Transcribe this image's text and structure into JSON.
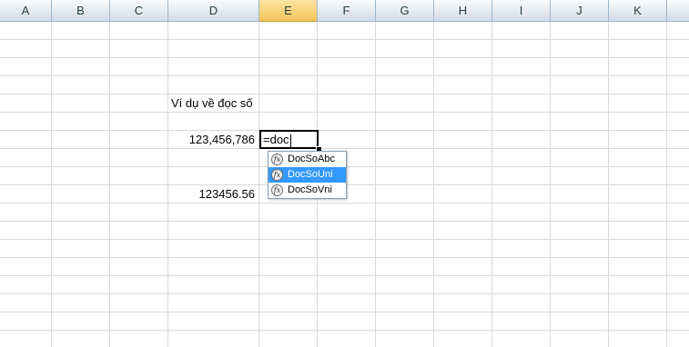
{
  "columns": [
    {
      "key": "A",
      "label": "A"
    },
    {
      "key": "B",
      "label": "B"
    },
    {
      "key": "C",
      "label": "C"
    },
    {
      "key": "D",
      "label": "D"
    },
    {
      "key": "E",
      "label": "E"
    },
    {
      "key": "F",
      "label": "F"
    },
    {
      "key": "G",
      "label": "G"
    },
    {
      "key": "H",
      "label": "H"
    },
    {
      "key": "I",
      "label": "I"
    },
    {
      "key": "J",
      "label": "J"
    },
    {
      "key": "K",
      "label": "K"
    }
  ],
  "selected_column": "E",
  "cells": {
    "d6": "Ví dụ về đọc số",
    "d8": "123,456,786",
    "d11": "123456.56"
  },
  "editor": {
    "value": "=doc"
  },
  "autocomplete": {
    "items": [
      {
        "label": "DocSoAbc",
        "icon": "function-icon",
        "highlighted": false
      },
      {
        "label": "DocSoUni",
        "icon": "function-icon",
        "highlighted": true
      },
      {
        "label": "DocSoVni",
        "icon": "function-icon",
        "highlighted": false
      }
    ]
  },
  "colors": {
    "selection_header": "#f2c457",
    "highlight": "#3399ff",
    "grid": "#d9d9d9"
  }
}
